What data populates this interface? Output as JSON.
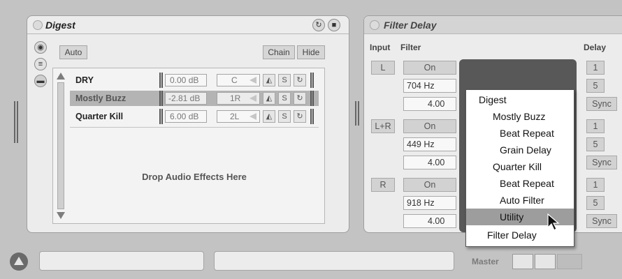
{
  "digest": {
    "title": "Digest",
    "auto_label": "Auto",
    "chain_label": "Chain",
    "hide_label": "Hide",
    "drop_hint": "Drop Audio Effects Here",
    "chains": [
      {
        "name": "DRY",
        "volume": "0.00 dB",
        "pan": "C",
        "solo": "S",
        "selected": false
      },
      {
        "name": "Mostly Buzz",
        "volume": "-2.81 dB",
        "pan": "1R",
        "solo": "S",
        "selected": true
      },
      {
        "name": "Quarter Kill",
        "volume": "6.00 dB",
        "pan": "2L",
        "solo": "S",
        "selected": false
      }
    ]
  },
  "filter_delay": {
    "title": "Filter Delay",
    "headers": {
      "input": "Input",
      "filter": "Filter",
      "delay": "Delay"
    },
    "rows": [
      {
        "input": "L",
        "on": "On",
        "freq": "704 Hz",
        "q": "4.00",
        "delay_a": "1",
        "delay_b": "5",
        "sync": "Sync"
      },
      {
        "input": "L+R",
        "on": "On",
        "freq": "449 Hz",
        "q": "4.00",
        "delay_a": "1",
        "delay_b": "5",
        "sync": "Sync"
      },
      {
        "input": "R",
        "on": "On",
        "freq": "918 Hz",
        "q": "4.00",
        "delay_a": "1",
        "delay_b": "5",
        "sync": "Sync"
      }
    ]
  },
  "context_menu": {
    "items": [
      {
        "label": "Digest",
        "indent": 0
      },
      {
        "label": "Mostly Buzz",
        "indent": 1
      },
      {
        "label": "Beat Repeat",
        "indent": 2
      },
      {
        "label": "Grain Delay",
        "indent": 2
      },
      {
        "label": "Quarter Kill",
        "indent": 1
      },
      {
        "label": "Beat Repeat",
        "indent": 2
      },
      {
        "label": "Auto Filter",
        "indent": 2
      },
      {
        "label": "Utility",
        "indent": 2,
        "hovered": true
      },
      {
        "label": "Filter Delay",
        "indent": 0
      }
    ]
  },
  "footer": {
    "master_label": "Master"
  }
}
